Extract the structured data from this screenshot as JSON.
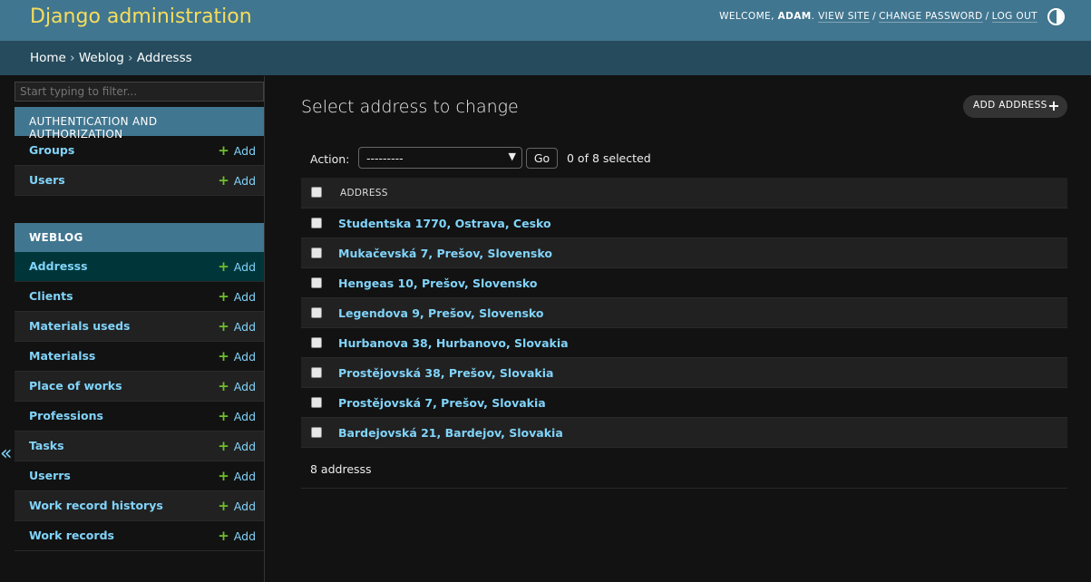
{
  "header": {
    "branding": "Django administration",
    "welcome_text": "WELCOME,",
    "username": "ADAM",
    "links": [
      "VIEW SITE",
      "CHANGE PASSWORD",
      "LOG OUT"
    ]
  },
  "breadcrumbs": [
    "Home",
    "Weblog",
    "Addresss"
  ],
  "sidebar": {
    "filter_placeholder": "Start typing to filter...",
    "modules": [
      {
        "caption": "AUTHENTICATION AND AUTHORIZATION",
        "models": [
          {
            "name": "Groups",
            "add": "Add"
          },
          {
            "name": "Users",
            "add": "Add"
          }
        ]
      },
      {
        "caption": "WEBLOG",
        "models": [
          {
            "name": "Addresss",
            "add": "Add",
            "current": true
          },
          {
            "name": "Clients",
            "add": "Add"
          },
          {
            "name": "Materials useds",
            "add": "Add"
          },
          {
            "name": "Materialss",
            "add": "Add"
          },
          {
            "name": "Place of works",
            "add": "Add"
          },
          {
            "name": "Professions",
            "add": "Add"
          },
          {
            "name": "Tasks",
            "add": "Add"
          },
          {
            "name": "Userrs",
            "add": "Add"
          },
          {
            "name": "Work record historys",
            "add": "Add"
          },
          {
            "name": "Work records",
            "add": "Add"
          }
        ]
      }
    ],
    "collapse_icon": "«"
  },
  "main": {
    "title": "Select address to change",
    "add_button": "ADD ADDRESS",
    "actions": {
      "label": "Action:",
      "selected_option": "---------",
      "go_label": "Go",
      "selected_count": "0 of 8 selected"
    },
    "table": {
      "column_header": "ADDRESS",
      "rows": [
        "Studentska 1770, Ostrava, Cesko",
        "Mukačevská 7, Prešov, Slovensko",
        "Hengeas 10, Prešov, Slovensko",
        "Legendova 9, Prešov, Slovensko",
        "Hurbanova 38, Hurbanovo, Slovakia",
        "Prostějovská 38, Prešov, Slovakia",
        "Prostějovská 7, Prešov, Slovakia",
        "Bardejovská 21, Bardejov, Slovakia"
      ]
    },
    "paginator": "8 addresss"
  },
  "colors": {
    "header_bg": "#417690",
    "branding": "#f5dd5d",
    "breadcrumbs_bg": "#264b5d",
    "link": "#81d4fa",
    "add_plus": "#70bf2b",
    "current_row": "#00363a"
  },
  "icons": {
    "theme_toggle": "half-circle-icon",
    "add": "plus-icon",
    "select_caret": "chevron-down-icon",
    "collapse": "double-chevron-left-icon"
  }
}
